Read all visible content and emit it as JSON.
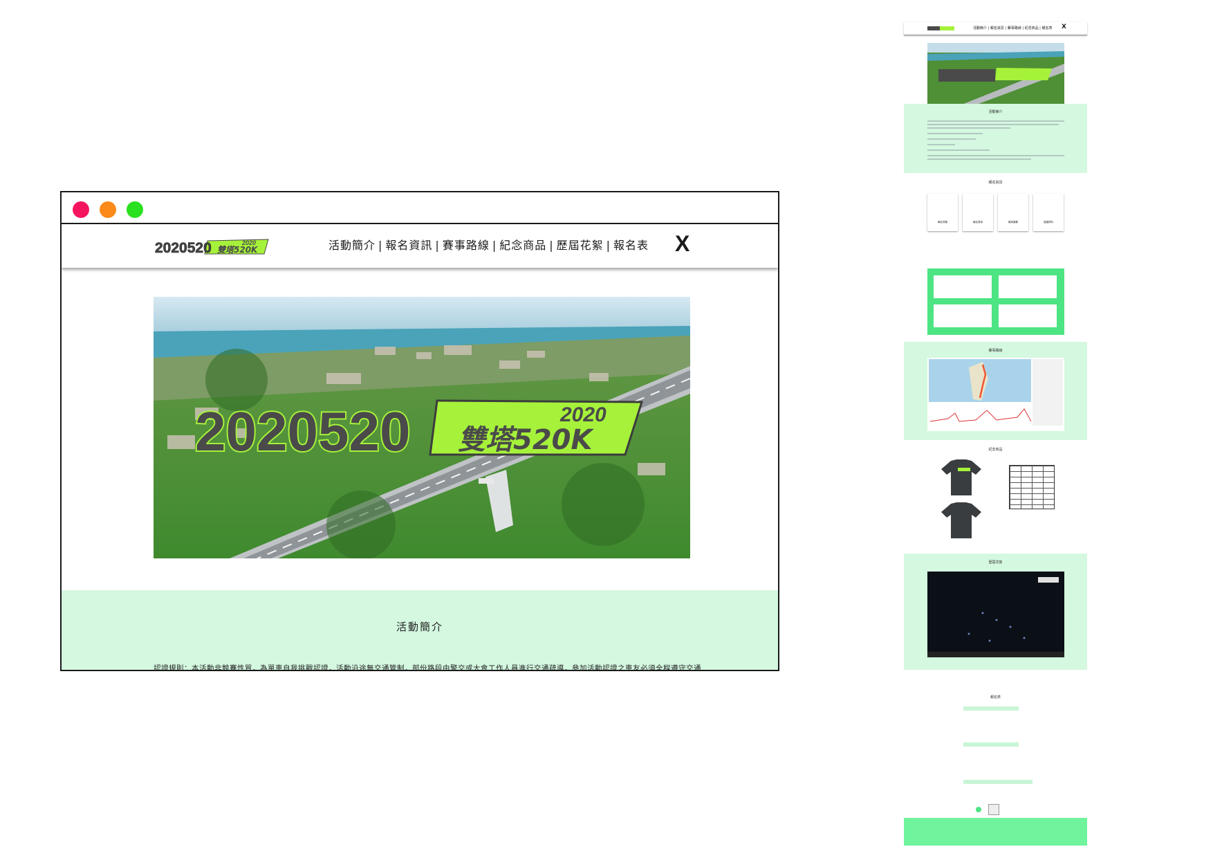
{
  "window": {
    "controls": [
      "close-dot",
      "minimize-dot",
      "maximize-dot"
    ],
    "colors": {
      "close": "#f5155f",
      "minimize": "#fb8a19",
      "maximize": "#2ae11f"
    }
  },
  "header": {
    "logo_text": "2020520",
    "logo_year": "2020",
    "logo_event": "雙塔520K",
    "nav": [
      "活動簡介",
      "報名資訊",
      "賽事路線",
      "紀念商品",
      "歷屆花絮",
      "報名表"
    ],
    "separator": "|",
    "close_label": "X"
  },
  "hero": {
    "title_number": "2020520",
    "title_year": "2020",
    "title_event": "雙塔520K"
  },
  "intro": {
    "heading": "活動簡介",
    "text": "認證規則：本活動非競賽性質，為單車自我挑戰認證，活動沿途無交通管制，部份路段由警交或大會工作人員進行交通疏導，參加活動認證之車友必須全程遵守交通"
  },
  "thumbnail": {
    "nav_text": "活動簡介 | 報名資訊 | 賽事路線 | 紀念商品 | 報名表",
    "close_label": "X",
    "section_headings": [
      "活動簡介",
      "報名資訊",
      "賽事路線",
      "紀念商品",
      "歷屆花絮",
      "報名表"
    ],
    "cards": [
      "報名資格",
      "報名費用",
      "報到服務",
      "認證資料"
    ],
    "colors": {
      "band": "#d4f8e0",
      "accent": "#4de483",
      "footer": "#6ff39c",
      "brand_green": "#a6f23a"
    }
  }
}
